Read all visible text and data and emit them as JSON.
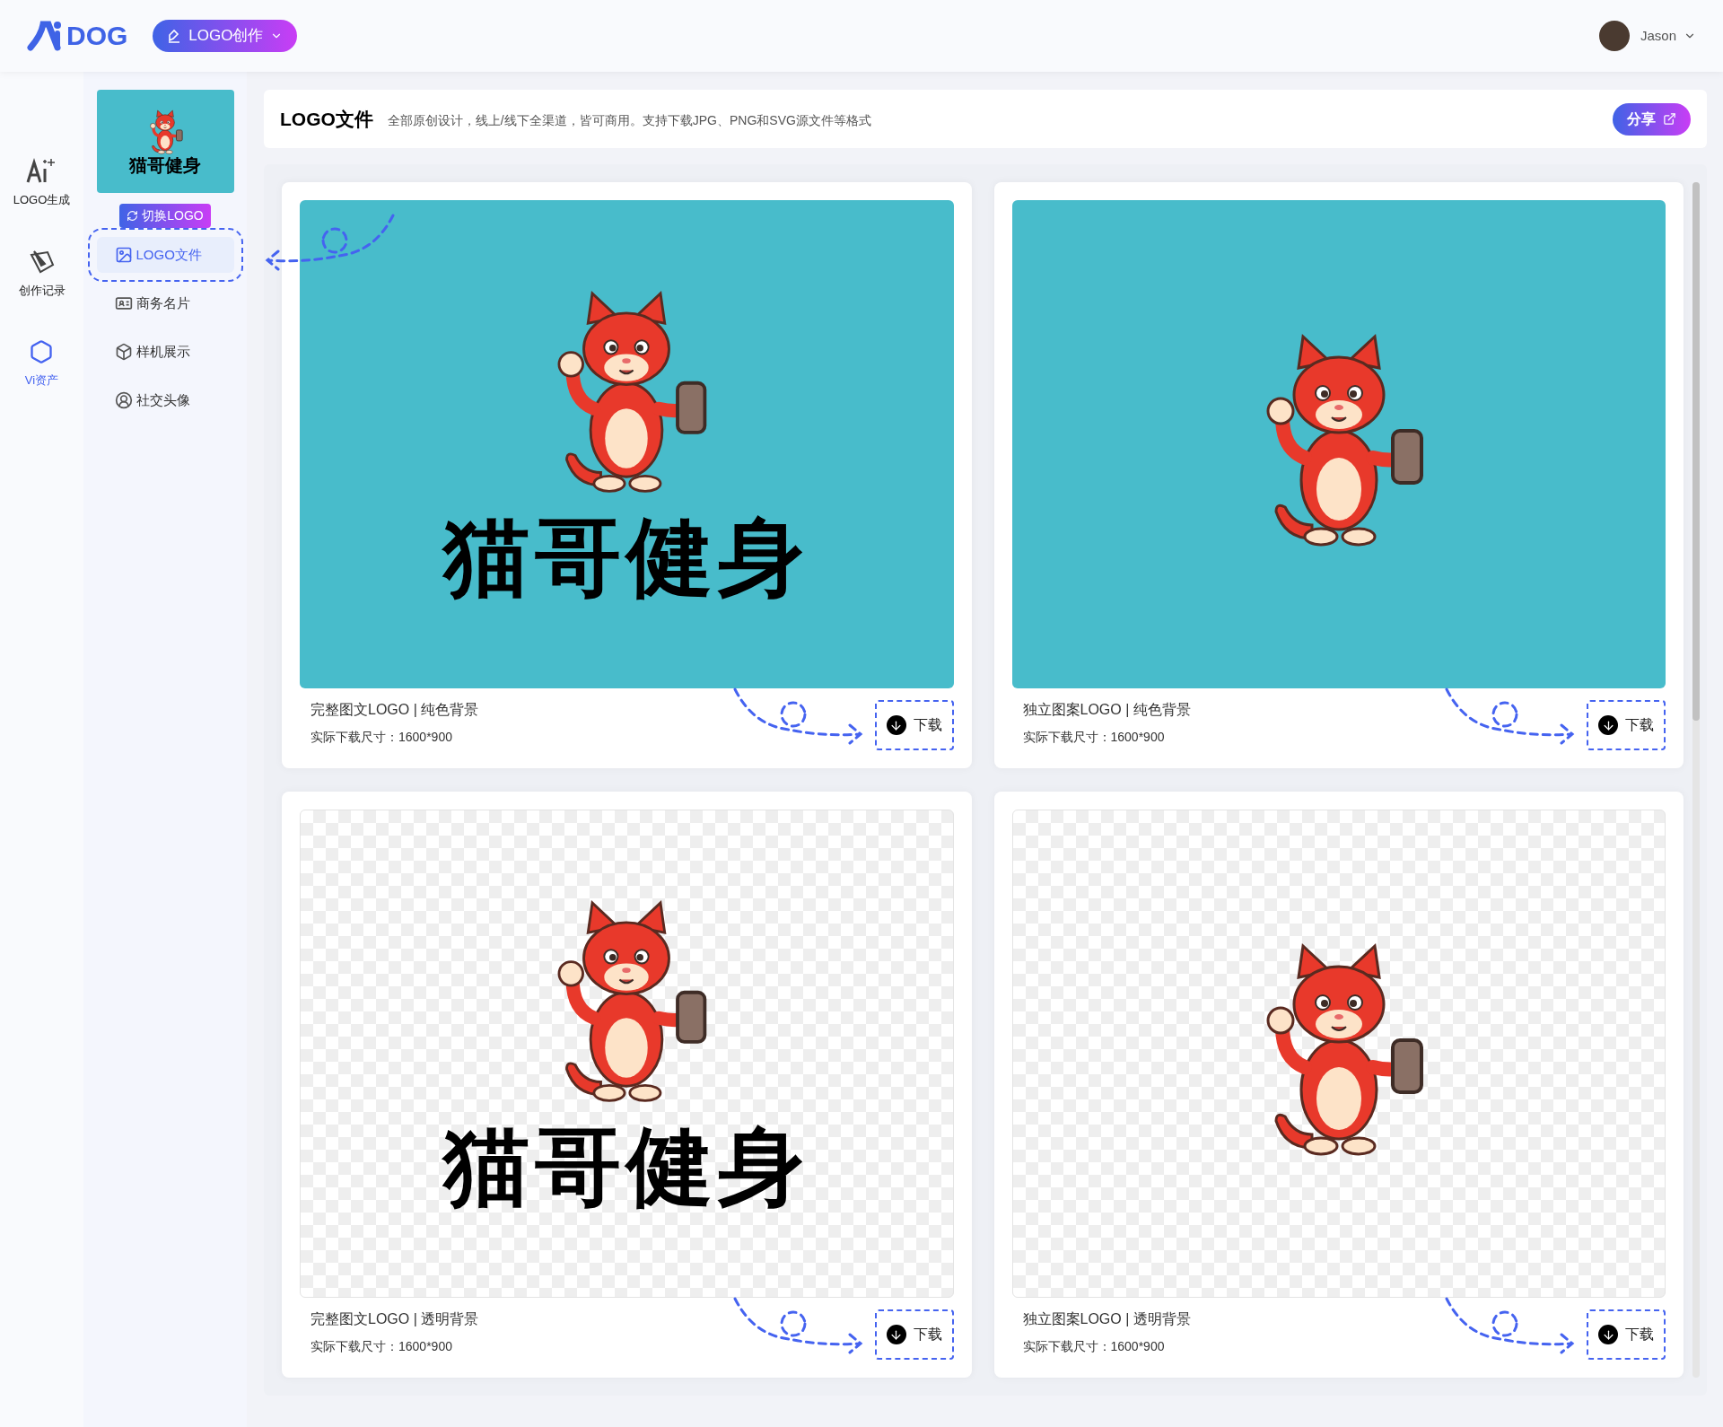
{
  "header": {
    "brand": "DOG",
    "menu_button": "LOGO创作",
    "user": "Jason"
  },
  "rail": [
    {
      "label": "LOGO生成",
      "kind": "ai",
      "selected": false
    },
    {
      "label": "创作记录",
      "kind": "record",
      "selected": false
    },
    {
      "label": "Vi资产",
      "kind": "vi",
      "selected": true
    }
  ],
  "sidebar": {
    "logo_preview_text": "猫哥健身",
    "switch_button": "切换LOGO",
    "items": [
      {
        "label": "LOGO文件",
        "kind": "image",
        "selected": true
      },
      {
        "label": "商务名片",
        "kind": "card",
        "selected": false
      },
      {
        "label": "样机展示",
        "kind": "box",
        "selected": false
      },
      {
        "label": "社交头像",
        "kind": "avatar",
        "selected": false
      }
    ]
  },
  "page": {
    "title": "LOGO文件",
    "subtitle": "全部原创设计，线上/线下全渠道，皆可商用。支持下载JPG、PNG和SVG源文件等格式",
    "share_button": "分享"
  },
  "cards": [
    {
      "kind": "full",
      "transparent": false,
      "logo_text": "猫哥健身",
      "title": "完整图文LOGO | 纯色背景",
      "size": "实际下载尺寸：1600*900",
      "download": "下载"
    },
    {
      "kind": "mark",
      "transparent": false,
      "title": "独立图案LOGO | 纯色背景",
      "size": "实际下载尺寸：1600*900",
      "download": "下载"
    },
    {
      "kind": "full",
      "transparent": true,
      "logo_text": "猫哥健身",
      "title": "完整图文LOGO | 透明背景",
      "size": "实际下载尺寸：1600*900",
      "download": "下载"
    },
    {
      "kind": "mark",
      "transparent": true,
      "title": "独立图案LOGO | 透明背景",
      "size": "实际下载尺寸：1600*900",
      "download": "下载"
    }
  ]
}
